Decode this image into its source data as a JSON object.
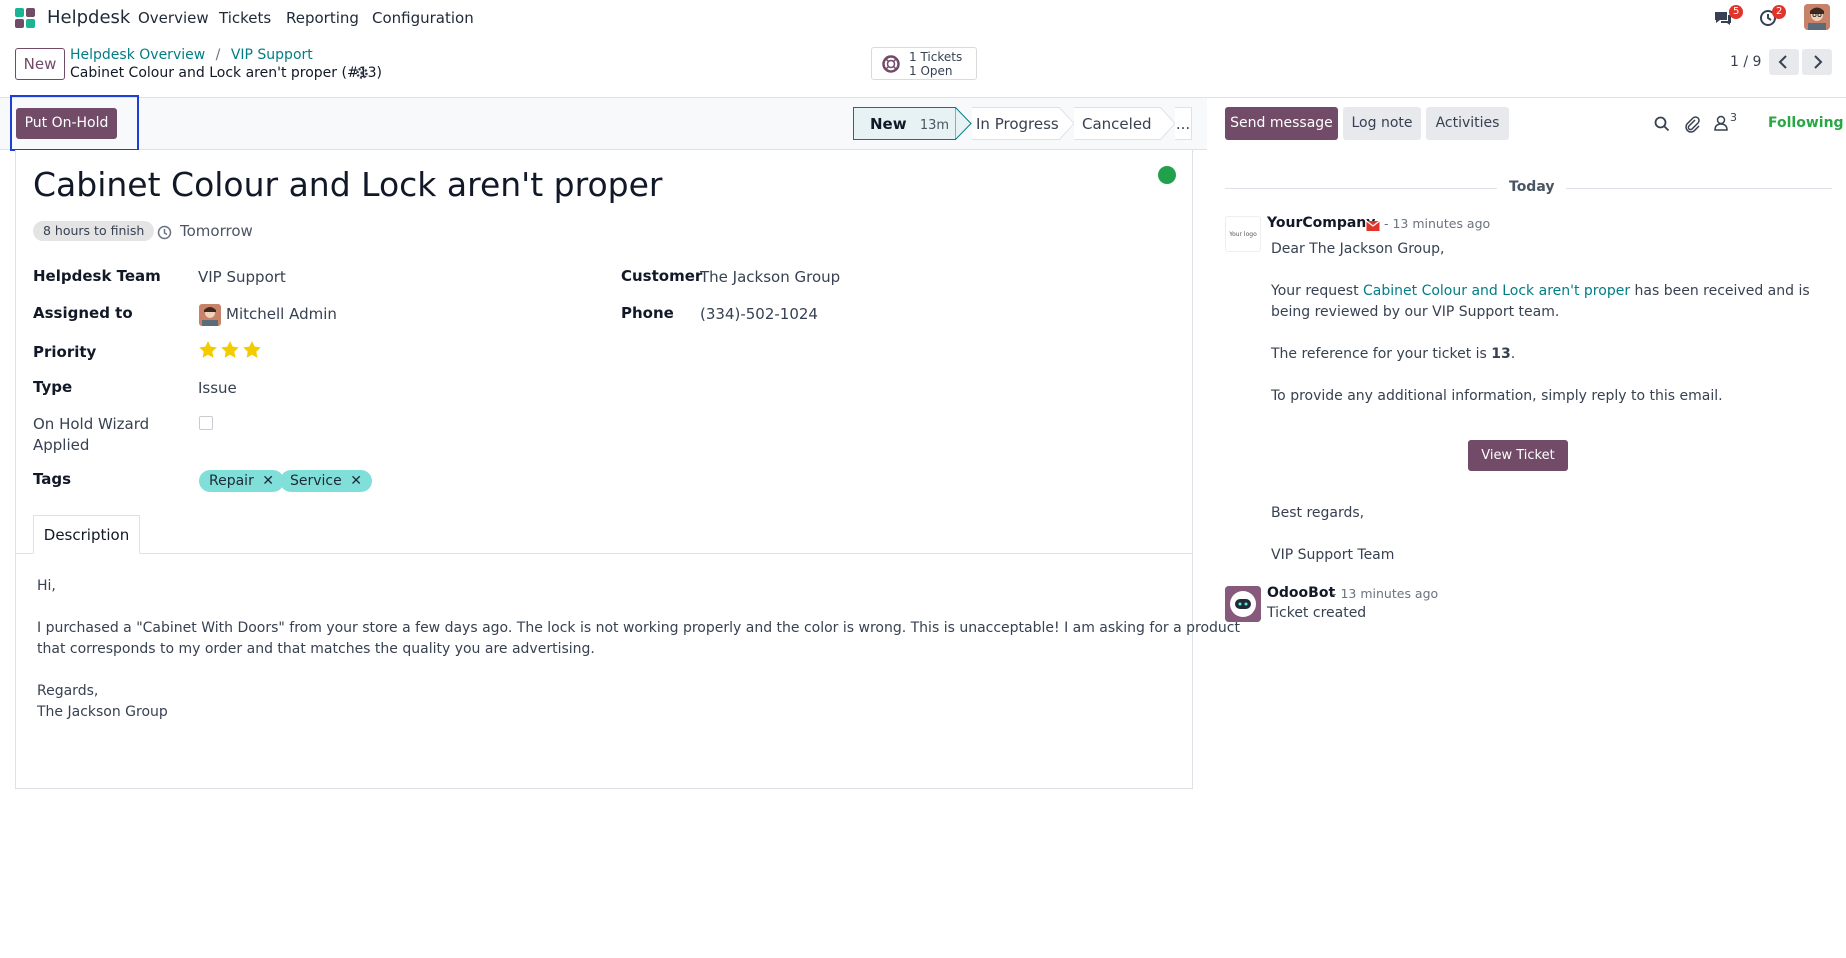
{
  "navbar": {
    "app_name": "Helpdesk",
    "menu": [
      "Overview",
      "Tickets",
      "Reporting",
      "Configuration"
    ],
    "messages_count": "5",
    "activities_count": "2"
  },
  "control_panel": {
    "new_label": "New",
    "breadcrumb": [
      "Helpdesk Overview",
      "VIP Support"
    ],
    "breadcrumb_sep": "/",
    "record_title": "Cabinet Colour and Lock aren't proper (#13)",
    "smart_tickets": "1 Tickets",
    "smart_open": "1 Open",
    "pager": "1 / 9"
  },
  "statusbar": {
    "hold_button": "Put On-Hold",
    "stages": [
      {
        "label": "New",
        "duration": "13m",
        "active": true
      },
      {
        "label": "In Progress",
        "active": false
      },
      {
        "label": "Canceled",
        "active": false
      },
      {
        "label": "...",
        "active": false
      }
    ]
  },
  "form": {
    "title": "Cabinet Colour and Lock aren't proper",
    "sla_badge": "8 hours to finish",
    "deadline": "Tomorrow",
    "kanban_state_color": "#21a14e",
    "fields": {
      "team_label": "Helpdesk Team",
      "team_value": "VIP Support",
      "assigned_label": "Assigned to",
      "assigned_value": "Mitchell Admin",
      "priority_label": "Priority",
      "priority_stars": 3,
      "priority_max": 3,
      "type_label": "Type",
      "type_value": "Issue",
      "onhold_label_1": "On Hold Wizard",
      "onhold_label_2": "Applied",
      "onhold_checked": false,
      "tags_label": "Tags",
      "customer_label": "Customer",
      "customer_value": "The Jackson Group",
      "phone_label": "Phone",
      "phone_value": "(334)-502-1024"
    },
    "tags": [
      "Repair",
      "Service"
    ],
    "tab": "Description",
    "description": {
      "greeting": "Hi,",
      "line1": "I purchased a \"Cabinet With Doors\" from your store a few days ago. The lock is not working properly and the color is wrong. This is unacceptable! I am asking for a product",
      "line2": "that corresponds to my order and that matches the quality you are advertising.",
      "closing": "Regards,",
      "signature": "The Jackson Group"
    }
  },
  "chatter": {
    "send_message": "Send message",
    "log_note": "Log note",
    "activities": "Activities",
    "followers_count": "3",
    "following": "Following",
    "date_separator": "Today",
    "messages": [
      {
        "author": "YourCompany",
        "time": "- 13 minutes ago",
        "avatar_text": "Your logo",
        "salutation": "Dear The Jackson Group,",
        "p1_before": "Your request ",
        "p1_link": "Cabinet Colour and Lock aren't proper",
        "p1_after": " has been received and is",
        "p1_line2": "being reviewed by our VIP Support team.",
        "p2_before": "The reference for your ticket is ",
        "p2_bold": "13",
        "p2_after": ".",
        "p3": "To provide any additional information, simply reply to this email.",
        "button": "View Ticket",
        "regards": "Best regards,",
        "team": "VIP Support Team"
      },
      {
        "author": "OdooBot",
        "time": "- 13 minutes ago",
        "body": "Ticket created"
      }
    ]
  },
  "colors": {
    "brand": "#714b67",
    "link": "#017e84",
    "tag": "#80dfd8",
    "following": "#28a745",
    "highlight_box": "#1e3fd6"
  }
}
